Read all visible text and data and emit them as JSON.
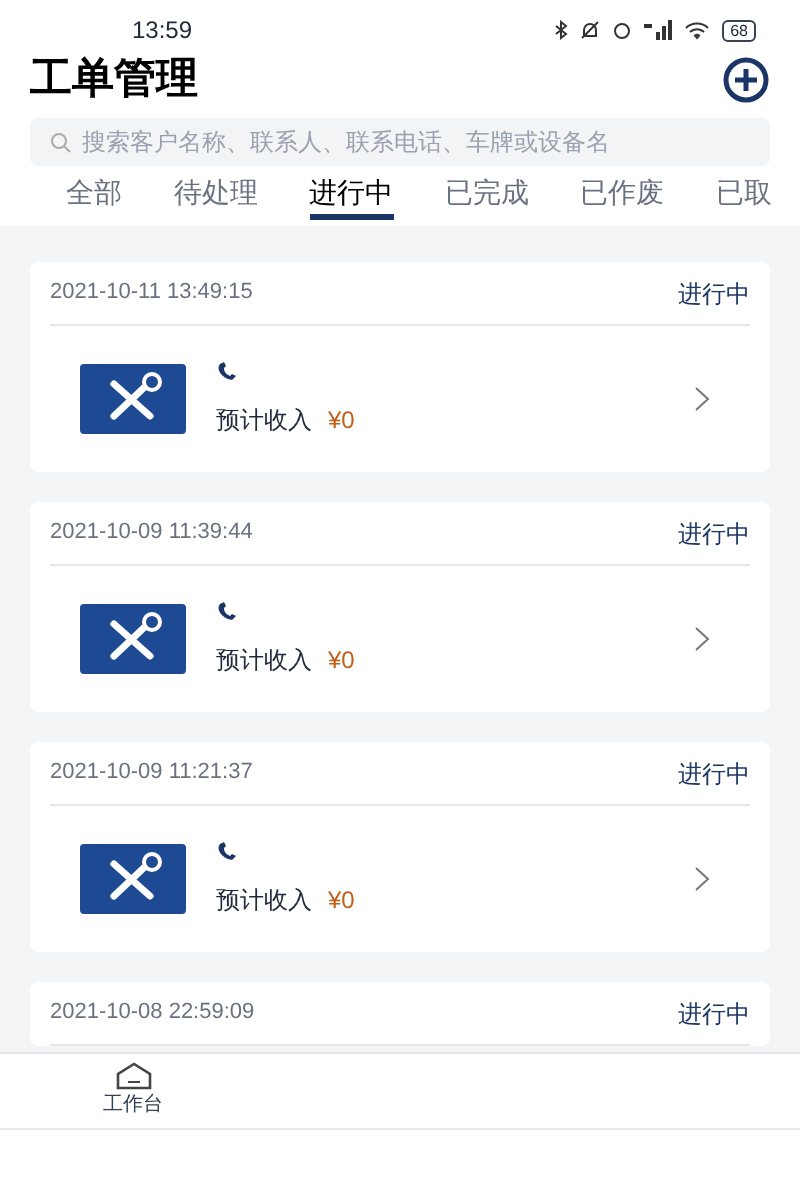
{
  "status_bar": {
    "time": "13:59",
    "battery": "68"
  },
  "header": {
    "title": "工单管理"
  },
  "search": {
    "placeholder": "搜索客户名称、联系人、联系电话、车牌或设备名"
  },
  "tabs": [
    {
      "label": "全部",
      "selected": false
    },
    {
      "label": "待处理",
      "selected": false
    },
    {
      "label": "进行中",
      "selected": true
    },
    {
      "label": "已完成",
      "selected": false
    },
    {
      "label": "已作废",
      "selected": false
    },
    {
      "label": "已取",
      "selected": false
    }
  ],
  "orders": [
    {
      "time": "2021-10-11 13:49:15",
      "status": "进行中",
      "income_label": "预计收入",
      "income": "¥0"
    },
    {
      "time": "2021-10-09 11:39:44",
      "status": "进行中",
      "income_label": "预计收入",
      "income": "¥0"
    },
    {
      "time": "2021-10-09 11:21:37",
      "status": "进行中",
      "income_label": "预计收入",
      "income": "¥0"
    },
    {
      "time": "2021-10-08 22:59:09",
      "status": "进行中"
    }
  ],
  "bottom_nav": [
    {
      "label": "工作台"
    }
  ]
}
